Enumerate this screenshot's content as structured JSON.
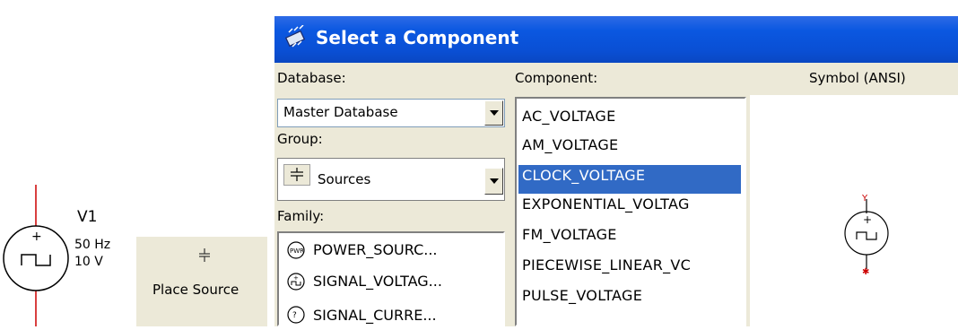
{
  "schematic": {
    "component_ref": "V1",
    "frequency": "50 Hz",
    "amplitude": "10 V"
  },
  "place_panel": {
    "icon": "source-ground-icon",
    "label": "Place Source"
  },
  "dialog": {
    "title": "Select a Component",
    "database_label": "Database:",
    "database_value": "Master Database",
    "group_label": "Group:",
    "group_value": "Sources",
    "family_label": "Family:",
    "families": [
      "POWER_SOURC...",
      "SIGNAL_VOLTAG...",
      "SIGNAL_CURRE..."
    ],
    "component_label": "Component:",
    "components": [
      "AC_VOLTAGE",
      "AM_VOLTAGE",
      "CLOCK_VOLTAGE",
      "EXPONENTIAL_VOLTAG",
      "FM_VOLTAGE",
      "PIECEWISE_LINEAR_VC",
      "PULSE_VOLTAGE"
    ],
    "selected_component": "CLOCK_VOLTAGE",
    "symbol_label": "Symbol (ANSI)"
  },
  "colors": {
    "titlebar": "#0a4fd4",
    "selection": "#316ac5",
    "dialog_bg": "#ece9d8",
    "schematic_red": "#cc0000"
  }
}
